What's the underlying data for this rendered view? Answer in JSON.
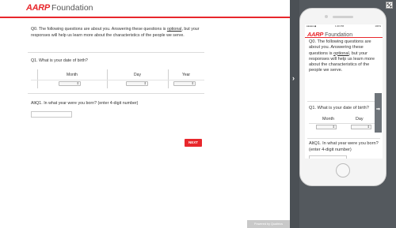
{
  "brand": {
    "name_red": "AARP",
    "name_gray": "Foundation",
    "accent": "#e8272c"
  },
  "survey": {
    "q0_part1": "Q0. The following questions are about you. Answering these questions is ",
    "q0_link": "optional",
    "q0_part2": ", but your responses will help us learn more about the characteristics of the people we serve.",
    "q1": "Q1. What is your date of birth?",
    "dob_headers": {
      "month": "Month",
      "day": "Day",
      "year": "Year"
    },
    "aq1": "AltQ1. In what year were you born? (enter 4-digit number)",
    "year_value": "",
    "next_label": "NEXT",
    "powered_by": "Powered by Qualtrics"
  },
  "mobile": {
    "status_left": "●●●●● ◆",
    "status_center": "1:20 PM",
    "status_right": "100%",
    "q0_part1": "Q0. The following questions are about you. Answering these questions is ",
    "q0_link": "optional",
    "q0_part2": ", but your responses will help us learn more about the characteristics of the people we serve.",
    "q1": "Q1. What is your date of birth?",
    "dob_headers": {
      "month": "Month",
      "day": "Day"
    },
    "aq1": "AltQ1. In what year were you born? (enter 4-digit number)"
  }
}
